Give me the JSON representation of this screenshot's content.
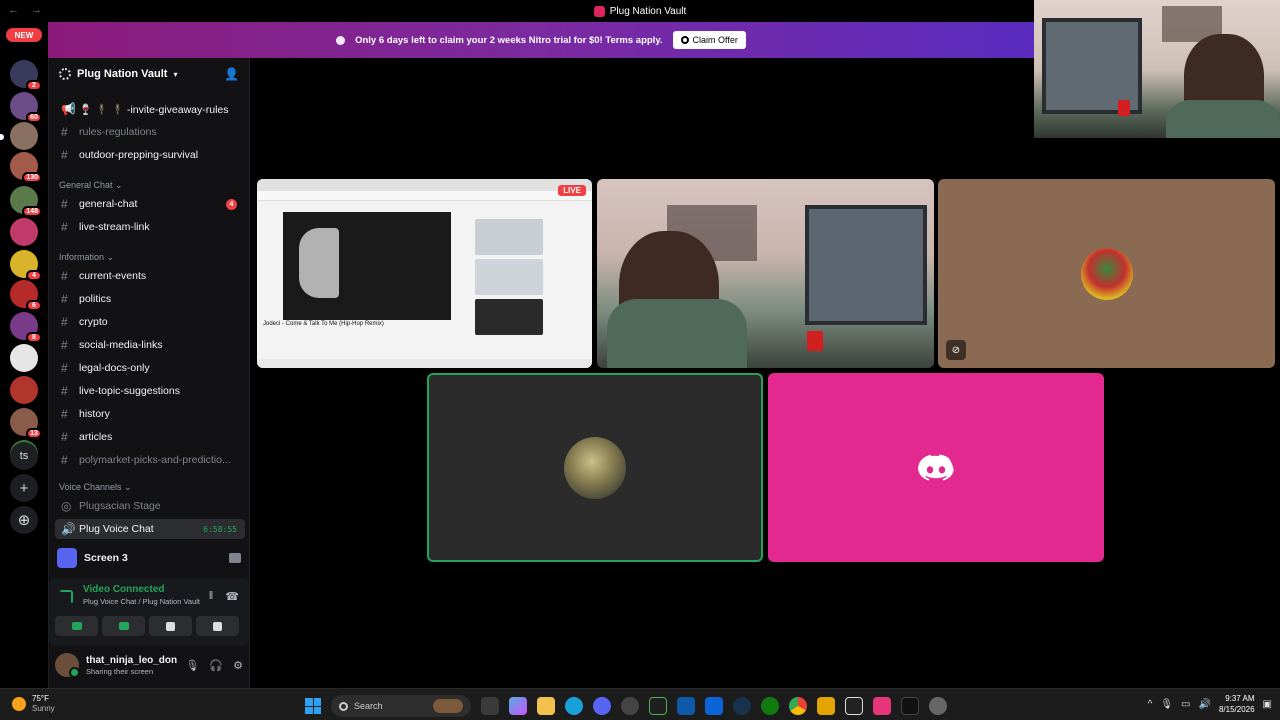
{
  "window": {
    "title": "Plug Nation Vault",
    "back": "←",
    "forward": "→"
  },
  "rail": {
    "new_label": "NEW",
    "servers": [
      {
        "badge": "2",
        "color": "#3a3a5c"
      },
      {
        "badge": "60",
        "color": "#6e4c8a"
      },
      {
        "badge": "",
        "color": "#8a7060",
        "active": true
      },
      {
        "badge": "130",
        "color": "#a35a4a"
      },
      {
        "badge": "148",
        "color": "#5a7a4a"
      },
      {
        "badge": "",
        "color": "#c03a6a"
      },
      {
        "badge": "4",
        "color": "#d9b32a"
      },
      {
        "badge": "6",
        "color": "#b72a2a"
      },
      {
        "badge": "8",
        "color": "#7a3a8a"
      },
      {
        "badge": "",
        "color": "#e6e6e6"
      },
      {
        "badge": "",
        "color": "#b0352a"
      },
      {
        "badge": "13",
        "color": "#8a5a4a"
      },
      {
        "badge": "",
        "color": "#3a7a3a"
      }
    ],
    "text_server": "ts",
    "add_icon": "+",
    "discover_icon": "⊕"
  },
  "banner": {
    "text": "Only 6 days left to claim your 2 weeks Nitro trial for $0! Terms apply.",
    "button": "Claim Offer"
  },
  "sidebar": {
    "server_name": "Plug Nation Vault",
    "channels_top": [
      {
        "name": "🍷 🕴 🕴 -invite-giveaway-rules",
        "muted": false,
        "type": "announce"
      },
      {
        "name": "rules-regulations",
        "muted": true
      },
      {
        "name": "outdoor-prepping-survival",
        "muted": false
      }
    ],
    "category_general": "General Chat",
    "channels_general": [
      {
        "name": "general-chat",
        "unread": "4"
      },
      {
        "name": "live-stream-link",
        "unread": ""
      }
    ],
    "category_info": "Information",
    "channels_info": [
      {
        "name": "current-events",
        "muted": false
      },
      {
        "name": "politics",
        "muted": false
      },
      {
        "name": "crypto",
        "muted": false
      },
      {
        "name": "social-media-links",
        "muted": false
      },
      {
        "name": "legal-docs-only",
        "muted": false
      },
      {
        "name": "live-topic-suggestions",
        "muted": false
      },
      {
        "name": "history",
        "muted": false
      },
      {
        "name": "articles",
        "muted": false
      },
      {
        "name": "polymarket-picks-and-predictio...",
        "muted": true
      }
    ],
    "category_voice": "Voice Channels",
    "voice_stage": "Plugsacian Stage",
    "voice_chat": "Plug Voice Chat",
    "voice_timer": "6:58:55"
  },
  "screen_panel": {
    "label": "Screen 3"
  },
  "voice_panel": {
    "status": "Video Connected",
    "location": "Plug Voice Chat / Plug Nation Vault"
  },
  "user_panel": {
    "username": "that_ninja_leo_don",
    "status": "Sharing their screen"
  },
  "tiles": {
    "live_badge": "LIVE",
    "screen_caption": "Jodeci - Come & Talk To Me (Hip-Hop Remix)"
  },
  "taskbar": {
    "temp": "75°F",
    "weather": "Sunny",
    "search_placeholder": "Search",
    "time": "9:37 AM",
    "date": "8/15/2026"
  }
}
